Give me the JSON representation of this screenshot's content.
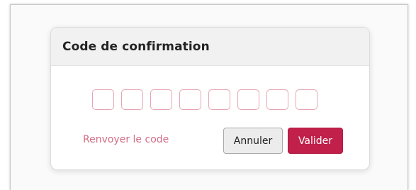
{
  "dialog": {
    "title": "Code de confirmation",
    "code_digits": [
      "",
      "",
      "",
      "",
      "",
      "",
      "",
      ""
    ],
    "resend_label": "Renvoyer le code",
    "cancel_label": "Annuler",
    "validate_label": "Valider"
  },
  "colors": {
    "accent": "#c0204a",
    "link": "#d16c85",
    "input_border": "#e7a5b4"
  }
}
